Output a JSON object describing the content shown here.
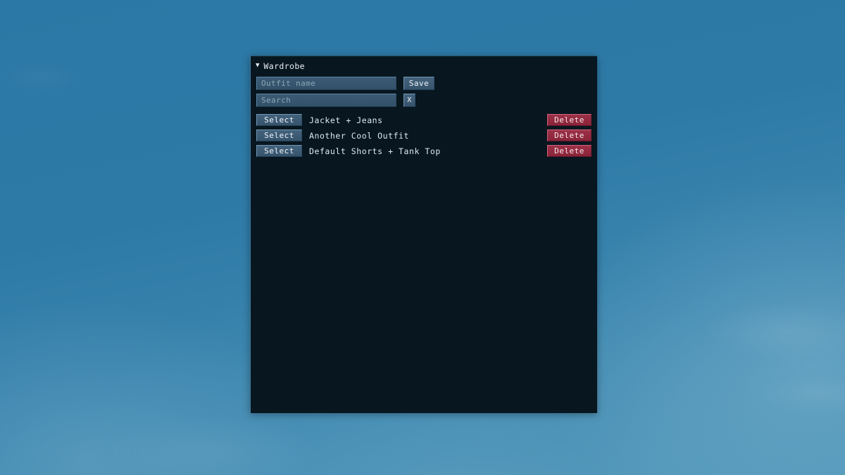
{
  "panel": {
    "title": "Wardrobe",
    "collapse_icon": "triangle-down-icon",
    "background_color": "#08161f",
    "border_color": "#3f7c9e"
  },
  "form": {
    "outfit_name_placeholder": "Outfit name",
    "outfit_name_value": "",
    "save_label": "Save",
    "search_placeholder": "Search",
    "search_value": "",
    "clear_label": "X"
  },
  "list": {
    "select_label": "Select",
    "delete_label": "Delete",
    "outfits": [
      {
        "name": "Jacket + Jeans"
      },
      {
        "name": "Another Cool Outfit"
      },
      {
        "name": "Default Shorts + Tank Top"
      }
    ]
  },
  "colors": {
    "desktop": "#2f7aa6",
    "panel_bg": "#08161f",
    "button_bg": "#3d5a74",
    "delete_bg": "#92293f",
    "delete_border": "#d3657e",
    "text": "#dfe9f0",
    "placeholder": "#8ca5b7"
  }
}
